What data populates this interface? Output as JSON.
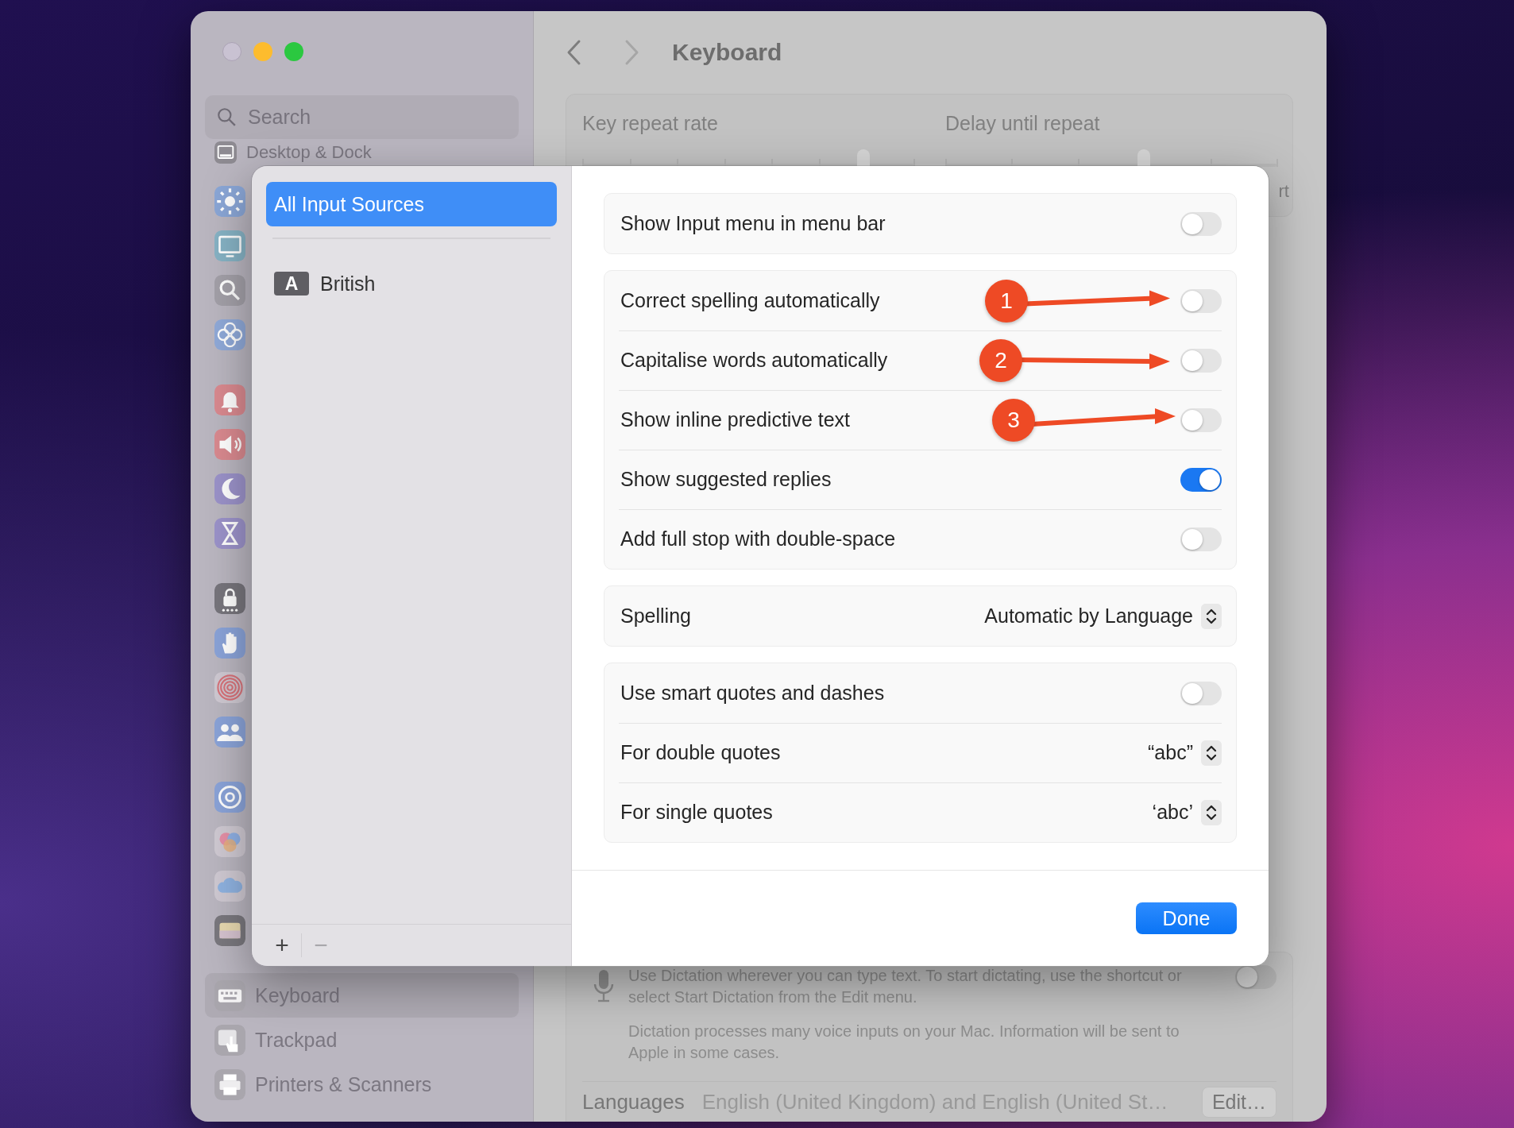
{
  "window": {
    "title": "Keyboard",
    "sidebar": {
      "search": {
        "placeholder": "Search"
      },
      "items": [
        {
          "label": "Desktop & Dock",
          "selected": false
        }
      ],
      "bottom_items": [
        {
          "label": "Keyboard",
          "selected": true
        },
        {
          "label": "Trackpad",
          "selected": false
        },
        {
          "label": "Printers & Scanners",
          "selected": false
        }
      ]
    },
    "sliders": [
      {
        "label": "Key repeat rate",
        "level": 0.85
      },
      {
        "label": "Delay until repeat",
        "level": 0.6
      }
    ],
    "slider_caption_fragment": "rt",
    "dictation": {
      "description": "Use Dictation wherever you can type text. To start dictating, use the shortcut or select Start Dictation from the Edit menu.",
      "note": "Dictation processes many voice inputs on your Mac. Information will be sent to Apple in some cases.",
      "on": false
    },
    "languages": {
      "label": "Languages",
      "value": "English (United Kingdom) and English (United St…",
      "button": "Edit…"
    }
  },
  "sheet": {
    "sources": [
      {
        "kind": "all",
        "label": "All Input Sources",
        "selected": true
      },
      {
        "kind": "layout",
        "badge": "A",
        "label": "British",
        "selected": false
      }
    ],
    "add_button": {
      "label": "+",
      "disabled": false
    },
    "remove_button": {
      "label": "−",
      "disabled": true
    },
    "groups": [
      {
        "rows": [
          {
            "kind": "toggle",
            "label": "Show Input menu in menu bar",
            "on": false
          }
        ]
      },
      {
        "rows": [
          {
            "kind": "toggle",
            "label": "Correct spelling automatically",
            "on": false,
            "annotation": "1"
          },
          {
            "kind": "toggle",
            "label": "Capitalise words automatically",
            "on": false,
            "annotation": "2"
          },
          {
            "kind": "toggle",
            "label": "Show inline predictive text",
            "on": false,
            "annotation": "3"
          },
          {
            "kind": "toggle",
            "label": "Show suggested replies",
            "on": true
          },
          {
            "kind": "toggle",
            "label": "Add full stop with double-space",
            "on": false
          }
        ]
      },
      {
        "rows": [
          {
            "kind": "popup",
            "label": "Spelling",
            "value": "Automatic by Language"
          }
        ]
      },
      {
        "rows": [
          {
            "kind": "toggle",
            "label": "Use smart quotes and dashes",
            "on": false
          },
          {
            "kind": "popup",
            "label": "For double quotes",
            "value": "“abc”"
          },
          {
            "kind": "popup",
            "label": "For single quotes",
            "value": "‘abc’"
          }
        ]
      }
    ],
    "done_button": "Done"
  }
}
